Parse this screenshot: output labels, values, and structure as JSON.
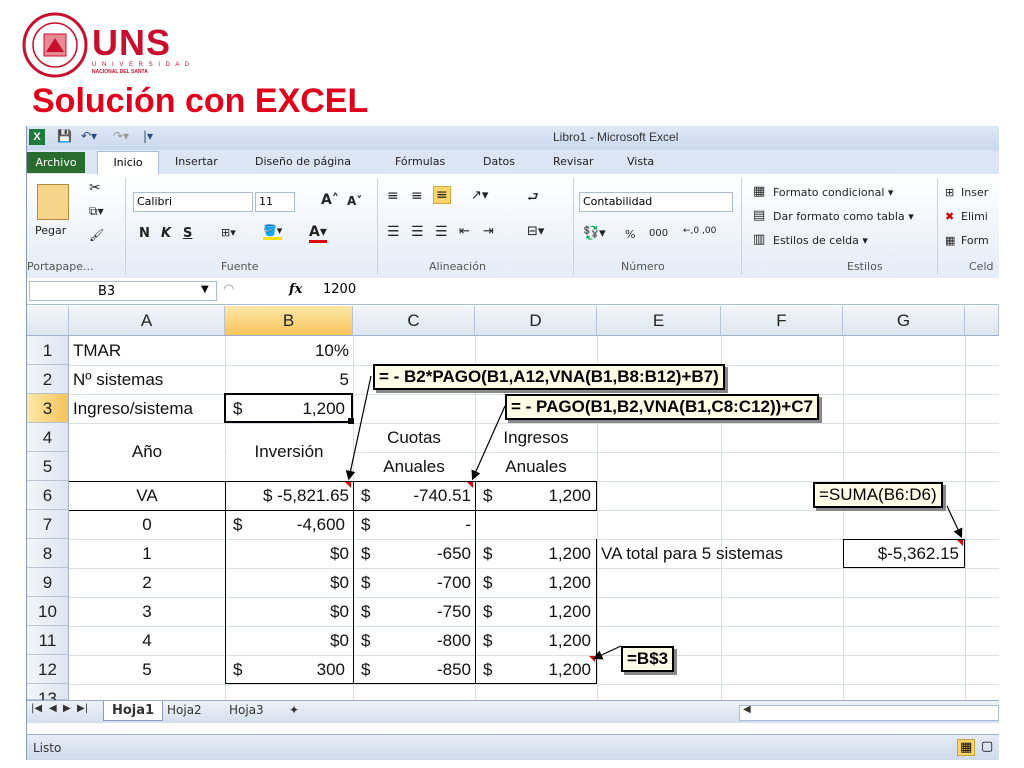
{
  "slide": {
    "brand": "UNS",
    "brand_sub1": "U N I V E R S I D A D",
    "brand_sub2": "NACIONAL DEL SANTA",
    "title": "Solución con EXCEL"
  },
  "window": {
    "title": "Libro1 - Microsoft Excel",
    "icon": "X"
  },
  "ribbon": {
    "tabs": [
      "Archivo",
      "Inicio",
      "Insertar",
      "Diseño de página",
      "Fórmulas",
      "Datos",
      "Revisar",
      "Vista"
    ],
    "paste_label": "Pegar",
    "font_name": "Calibri",
    "font_size": "11",
    "bold": "N",
    "italic": "K",
    "underline": "S",
    "number_format": "Contabilidad",
    "percent": "%",
    "thousands": "000",
    "dec_inc": "←,0 ,00",
    "dec_dec": ",00 →,0",
    "cond_format": "Formato condicional ▾",
    "table_format": "Dar formato como tabla ▾",
    "cell_styles": "Estilos de celda ▾",
    "insert": "Inser",
    "delete": "Elimi",
    "format": "Form",
    "groups": [
      "Portapape...",
      "Fuente",
      "Alineación",
      "Número",
      "Estilos",
      "Celd"
    ]
  },
  "formula_bar": {
    "name_box": "B3",
    "fx": "fx",
    "value": "1200"
  },
  "columns": [
    "A",
    "B",
    "C",
    "D",
    "E",
    "F",
    "G"
  ],
  "rows": [
    "1",
    "2",
    "3",
    "4",
    "5",
    "6",
    "7",
    "8",
    "9",
    "10",
    "11",
    "12",
    "13"
  ],
  "cells": {
    "A1": "TMAR",
    "B1": "10%",
    "A2": "Nº sistemas",
    "B2": "5",
    "A3": "Ingreso/sistema",
    "B3_cur": "$",
    "B3_val": "1,200",
    "A45": "Año",
    "B45": "Inversión",
    "C4": "Cuotas",
    "C5": "Anuales",
    "D4": "Ingresos",
    "D5": "Anuales",
    "A6": "VA",
    "B6": "$ -5,821.65",
    "C6_cur": "$",
    "C6_val": "-740.51",
    "D6_cur": "$",
    "D6_val": "1,200",
    "A7": "0",
    "B7_cur": "$",
    "B7_val": "-4,600",
    "C7_cur": "$",
    "C7_val": "-",
    "A8": "1",
    "B8": "$0",
    "C8_cur": "$",
    "C8_val": "-650",
    "D8_cur": "$",
    "D8_val": "1,200",
    "A9": "2",
    "B9": "$0",
    "C9_cur": "$",
    "C9_val": "-700",
    "D9_cur": "$",
    "D9_val": "1,200",
    "A10": "3",
    "B10": "$0",
    "C10_cur": "$",
    "C10_val": "-750",
    "D10_cur": "$",
    "D10_val": "1,200",
    "A11": "4",
    "B11": "$0",
    "C11_cur": "$",
    "C11_val": "-800",
    "D11_cur": "$",
    "D11_val": "1,200",
    "A12": "5",
    "B12_cur": "$",
    "B12_val": "300",
    "C12_cur": "$",
    "C12_val": "-850",
    "D12_cur": "$",
    "D12_val": "1,200",
    "E8": "VA total para 5 sistemas",
    "G8": "$-5,362.15"
  },
  "annotations": {
    "formula_c6": "= - B2*PAGO(B1,A12,VNA(B1,B8:B12)+B7)",
    "formula_d6": "= - PAGO(B1,B2,VNA(B1,C8:C12))+C7",
    "formula_g8": "=SUMA(B6:D6)",
    "formula_d12": "=B$3"
  },
  "sheets": [
    "Hoja1",
    "Hoja2",
    "Hoja3"
  ],
  "status": "Listo"
}
